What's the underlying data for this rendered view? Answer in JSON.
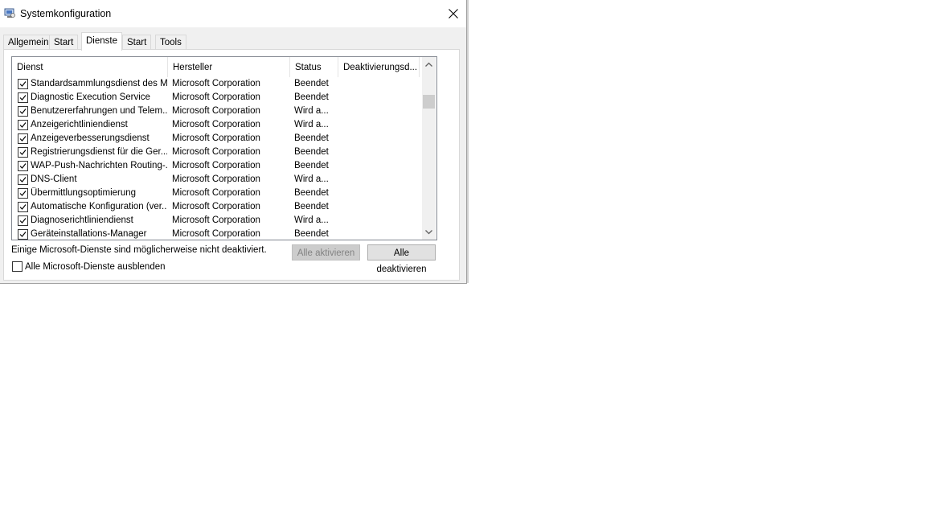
{
  "window": {
    "title": "Systemkonfiguration"
  },
  "tabs": [
    {
      "label": "Allgemein",
      "active": false
    },
    {
      "label": "Start",
      "active": false
    },
    {
      "label": "Dienste",
      "active": true
    },
    {
      "label": "Start",
      "active": false
    },
    {
      "label": "Tools",
      "active": false
    }
  ],
  "services": {
    "columns": [
      "Dienst",
      "Hersteller",
      "Status",
      "Deaktivierungsd..."
    ],
    "rows": [
      {
        "name": "Standardsammlungsdienst des M...",
        "vendor": "Microsoft Corporation",
        "status": "Beendet",
        "checked": true
      },
      {
        "name": "Diagnostic Execution Service",
        "vendor": "Microsoft Corporation",
        "status": "Beendet",
        "checked": true
      },
      {
        "name": "Benutzererfahrungen und Telem...",
        "vendor": "Microsoft Corporation",
        "status": "Wird a...",
        "checked": true
      },
      {
        "name": "Anzeigerichtliniendienst",
        "vendor": "Microsoft Corporation",
        "status": "Wird a...",
        "checked": true
      },
      {
        "name": "Anzeigeverbesserungsdienst",
        "vendor": "Microsoft Corporation",
        "status": "Beendet",
        "checked": true
      },
      {
        "name": "Registrierungsdienst für die Ger...",
        "vendor": "Microsoft Corporation",
        "status": "Beendet",
        "checked": true
      },
      {
        "name": "WAP-Push-Nachrichten Routing-...",
        "vendor": "Microsoft Corporation",
        "status": "Beendet",
        "checked": true
      },
      {
        "name": "DNS-Client",
        "vendor": "Microsoft Corporation",
        "status": "Wird a...",
        "checked": true
      },
      {
        "name": "Übermittlungsoptimierung",
        "vendor": "Microsoft Corporation",
        "status": "Beendet",
        "checked": true
      },
      {
        "name": "Automatische Konfiguration (ver...",
        "vendor": "Microsoft Corporation",
        "status": "Beendet",
        "checked": true
      },
      {
        "name": "Diagnoserichtliniendienst",
        "vendor": "Microsoft Corporation",
        "status": "Wird a...",
        "checked": true
      },
      {
        "name": "Geräteinstallations-Manager",
        "vendor": "Microsoft Corporation",
        "status": "Beendet",
        "checked": true
      }
    ]
  },
  "footer": {
    "info": "Einige Microsoft-Dienste sind möglicherweise nicht deaktiviert.",
    "activate_all": "Alle aktivieren",
    "deactivate_all": "Alle deaktivieren",
    "hide_microsoft": "Alle Microsoft-Dienste ausblenden"
  }
}
